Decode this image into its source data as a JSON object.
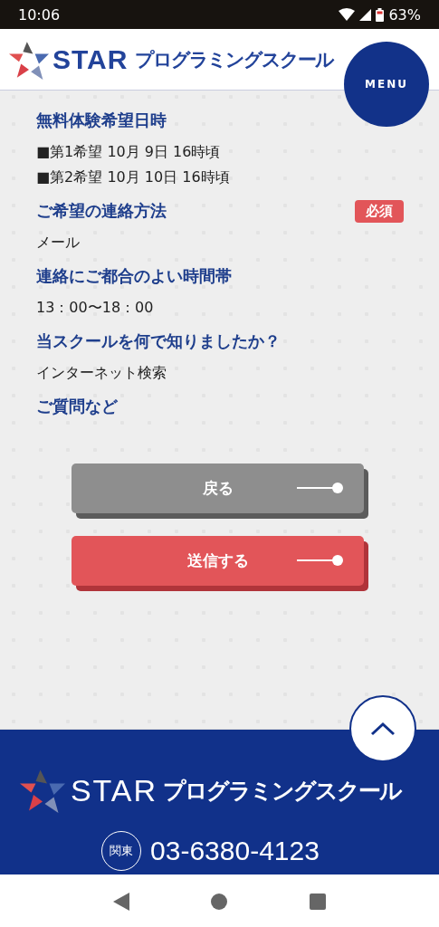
{
  "status_bar": {
    "time": "10:06",
    "battery": "63%"
  },
  "header": {
    "logo": "STAR",
    "logo_sub": "プログラミングスクール",
    "menu": "MENU"
  },
  "required_label": "必須",
  "fields": [
    {
      "label": "無料体験希望日時",
      "required": false,
      "values": [
        "■第1希望 10月 9日 16時頃",
        "■第2希望 10月 10日 16時頃"
      ]
    },
    {
      "label": "ご希望の連絡方法",
      "required": true,
      "values": [
        "メール"
      ]
    },
    {
      "label": "連絡にご都合のよい時間帯",
      "required": false,
      "values": [
        "13：00〜18：00"
      ]
    },
    {
      "label": "当スクールを何で知りましたか？",
      "required": false,
      "values": [
        "インターネット検索"
      ]
    },
    {
      "label": "ご質問など",
      "required": false
    }
  ],
  "buttons": [
    {
      "label": "戻る",
      "kind": "back"
    },
    {
      "label": "送信する",
      "kind": "submit"
    }
  ],
  "footer": {
    "logo": "STAR",
    "logo_sub": "プログラミングスクール",
    "region": "関東",
    "phone": "03-6380-4123"
  }
}
